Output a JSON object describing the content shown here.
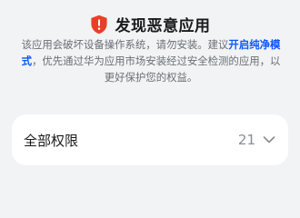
{
  "warning": {
    "icon": "shield-exclamation-icon",
    "title": "发现恶意应用",
    "message_prefix": "该应用会破坏设备操作系统，请勿安装。建议",
    "message_link": "开启纯净模式",
    "message_suffix": "，优先通过华为应用市场安装经过安全检测的应用，以更好保护您的权益。"
  },
  "permissions": {
    "label": "全部权限",
    "count": "21",
    "expand_icon": "chevron-down-icon"
  },
  "colors": {
    "background": "#f1f3f5",
    "shield": "#e84026",
    "link": "#0a59f7",
    "card": "#ffffff"
  }
}
